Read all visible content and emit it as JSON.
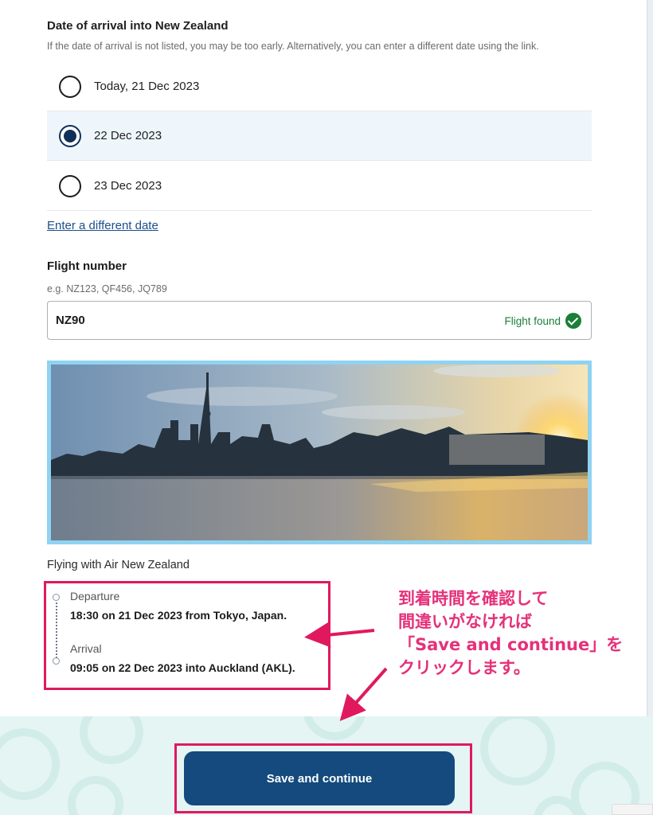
{
  "arrival": {
    "heading": "Date of arrival into New Zealand",
    "hint": "If the date of arrival is not listed, you may be too early. Alternatively, you can enter a different date using the link.",
    "options": [
      {
        "label": "Today, 21 Dec 2023",
        "selected": false
      },
      {
        "label": "22 Dec 2023",
        "selected": true
      },
      {
        "label": "23 Dec 2023",
        "selected": false
      }
    ],
    "different_date_link": "Enter a different date"
  },
  "flight": {
    "label": "Flight number",
    "hint": "e.g. NZ123, QF456, JQ789",
    "value": "NZ90",
    "status": "Flight found",
    "status_icon": "check-circle-icon"
  },
  "flying_with": "Flying with Air New Zealand",
  "itinerary": {
    "departure_title": "Departure",
    "departure_value": "18:30 on 21 Dec 2023 from Tokyo, Japan.",
    "arrival_title": "Arrival",
    "arrival_value": "09:05 on 22 Dec 2023 into Auckland (AKL)."
  },
  "annotation": {
    "lines": [
      "到着時間を確認して",
      "間違いがなければ",
      "「Save and continue」を",
      "クリックします。"
    ]
  },
  "save_button": "Save and continue",
  "colors": {
    "primary": "#144a7d",
    "selected_row": "#eef6fc",
    "success": "#1a7f37",
    "annotation": "#e0195e",
    "link": "#1c4f8a",
    "footer": "#e4f5f4"
  }
}
